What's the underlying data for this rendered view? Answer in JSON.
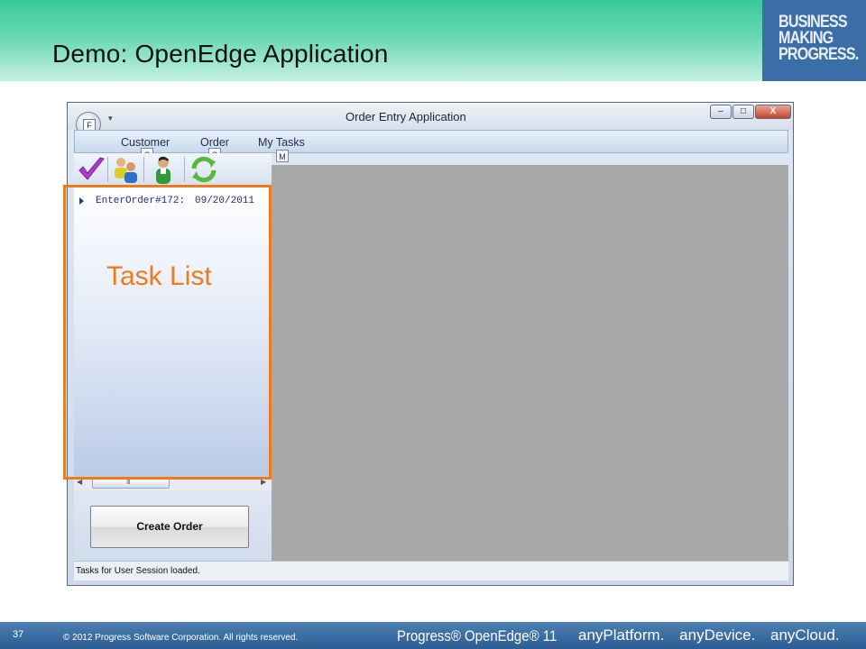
{
  "slide": {
    "title": "Demo: OpenEdge Application",
    "brand_logo": [
      "BUSINESS",
      "MAKING",
      "PROGRESS."
    ],
    "annotation_label": "Task List",
    "annotation_color": "#ee7a1c"
  },
  "window": {
    "title": "Order Entry Application",
    "app_button_keytip": "F",
    "controls": {
      "minimize": "–",
      "maximize": "□",
      "close": "X"
    }
  },
  "menu": {
    "items": [
      {
        "label": "Customer",
        "keytip": "C"
      },
      {
        "label": "Order",
        "keytip": "O"
      },
      {
        "label": "My Tasks",
        "keytip": "M"
      }
    ]
  },
  "toolbar": {
    "icons": [
      "checkmark-icon",
      "customers-group-icon",
      "user-icon",
      "refresh-icon"
    ]
  },
  "task_list": {
    "items": [
      {
        "name": "EnterOrder#172:",
        "date": "09/20/2011"
      }
    ],
    "scroll_grip": "III"
  },
  "buttons": {
    "create_order": "Create Order"
  },
  "status": {
    "text": "Tasks for User Session loaded."
  },
  "footer": {
    "page_number": "37",
    "copyright": "© 2012 Progress Software Corporation. All rights reserved.",
    "product": "Progress® OpenEdge® 11",
    "tagline": [
      "anyPlatform.",
      "anyDevice.",
      "anyCloud."
    ]
  },
  "colors": {
    "header_green": "#39c99a",
    "brand_blue": "#3b6ea6",
    "workspace_gray": "#a8a8a8",
    "footer_blue": "#2b5d95"
  }
}
